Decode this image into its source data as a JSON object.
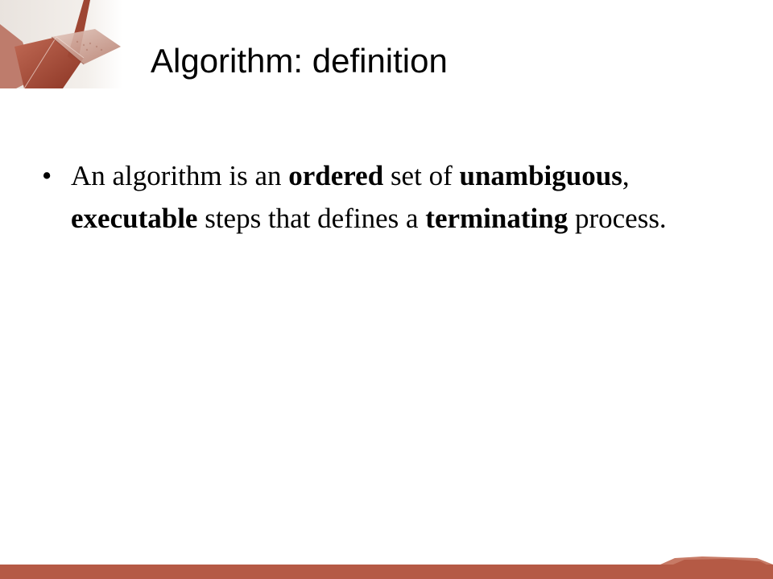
{
  "slide": {
    "title": "Algorithm: definition",
    "bullets": [
      {
        "marker": "•",
        "segments": [
          {
            "text": "An algorithm is an ",
            "bold": false
          },
          {
            "text": "ordered",
            "bold": true
          },
          {
            "text": " set of ",
            "bold": false
          },
          {
            "text": "unambiguous",
            "bold": true
          },
          {
            "text": ", ",
            "bold": false
          },
          {
            "text": "executable",
            "bold": true
          },
          {
            "text": " steps that defines a ",
            "bold": false
          },
          {
            "text": "terminating",
            "bold": true
          },
          {
            "text": " process.",
            "bold": false
          }
        ]
      }
    ]
  },
  "colors": {
    "accent": "#b55a45",
    "accent_dark": "#8f3a2a",
    "text": "#000000",
    "background": "#ffffff"
  },
  "decoration": {
    "top_left_icon": "origami-crane-icon"
  }
}
